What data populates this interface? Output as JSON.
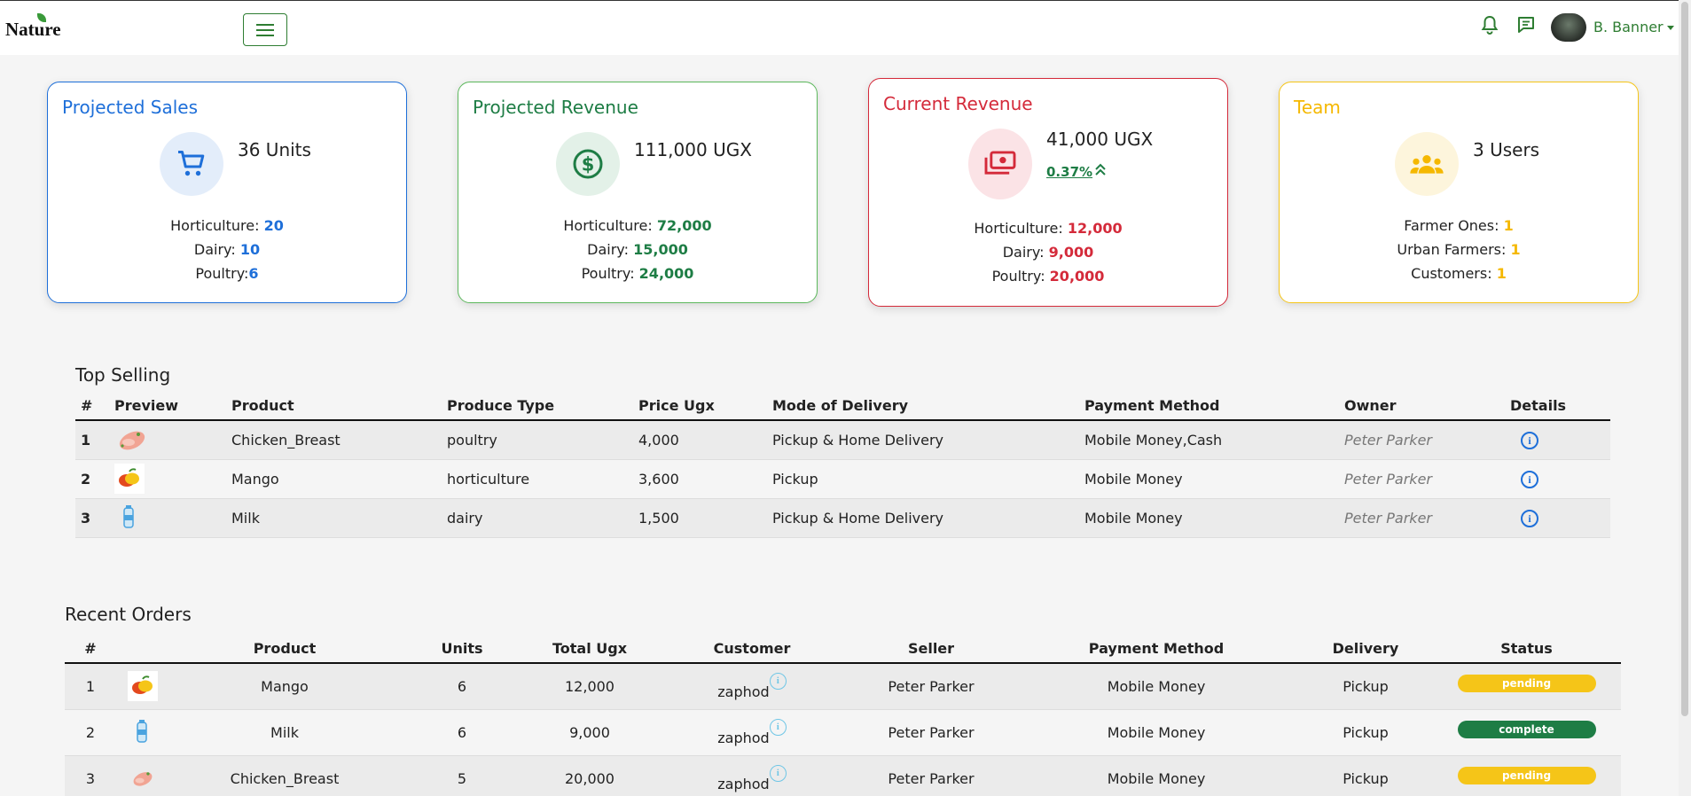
{
  "app": {
    "brand": "Nature",
    "user": "B. Banner"
  },
  "cards": {
    "projected_sales": {
      "title": "Projected Sales",
      "value": "36 Units",
      "lines": [
        {
          "label": "Horticulture: ",
          "value": "20"
        },
        {
          "label": "Dairy: ",
          "value": "10"
        },
        {
          "label": "Poultry:",
          "value": "6"
        }
      ]
    },
    "projected_revenue": {
      "title": "Projected Revenue",
      "value": "111,000 UGX",
      "lines": [
        {
          "label": "Horticulture: ",
          "value": "72,000"
        },
        {
          "label": "Dairy: ",
          "value": "15,000"
        },
        {
          "label": "Poultry: ",
          "value": "24,000"
        }
      ]
    },
    "current_revenue": {
      "title": "Current Revenue",
      "value": "41,000 UGX",
      "change": "0.37%",
      "lines": [
        {
          "label": "Horticulture: ",
          "value": "12,000"
        },
        {
          "label": "Dairy: ",
          "value": "9,000"
        },
        {
          "label": "Poultry: ",
          "value": "20,000"
        }
      ]
    },
    "team": {
      "title": "Team",
      "value": "3 Users",
      "lines": [
        {
          "label": "Farmer Ones: ",
          "value": "1"
        },
        {
          "label": "Urban Farmers: ",
          "value": "1"
        },
        {
          "label": "Customers: ",
          "value": "1"
        }
      ]
    }
  },
  "top_selling": {
    "title": "Top Selling",
    "headers": [
      "#",
      "Preview",
      "Product",
      "Produce Type",
      "Price Ugx",
      "Mode of Delivery",
      "Payment Method",
      "Owner",
      "Details"
    ],
    "rows": [
      {
        "n": "1",
        "product": "Chicken_Breast",
        "type": "poultry",
        "price": "4,000",
        "delivery": "Pickup & Home Delivery",
        "payment": "Mobile Money,Cash",
        "owner": "Peter Parker",
        "icon": "chicken-icon"
      },
      {
        "n": "2",
        "product": "Mango",
        "type": "horticulture",
        "price": "3,600",
        "delivery": "Pickup",
        "payment": "Mobile Money",
        "owner": "Peter Parker",
        "icon": "mango-icon"
      },
      {
        "n": "3",
        "product": "Milk",
        "type": "dairy",
        "price": "1,500",
        "delivery": "Pickup & Home Delivery",
        "payment": "Mobile Money",
        "owner": "Peter Parker",
        "icon": "milk-icon"
      }
    ]
  },
  "recent_orders": {
    "title": "Recent Orders",
    "headers": [
      "#",
      "Product",
      "Units",
      "Total Ugx",
      "Customer",
      "Seller",
      "Payment Method",
      "Delivery",
      "Status"
    ],
    "rows": [
      {
        "n": "1",
        "product": "Mango",
        "units": "6",
        "total": "12,000",
        "customer": "zaphod",
        "seller": "Peter Parker",
        "payment": "Mobile Money",
        "delivery": "Pickup",
        "status": "pending",
        "icon": "mango-icon"
      },
      {
        "n": "2",
        "product": "Milk",
        "units": "6",
        "total": "9,000",
        "customer": "zaphod",
        "seller": "Peter Parker",
        "payment": "Mobile Money",
        "delivery": "Pickup",
        "status": "complete",
        "icon": "milk-icon"
      },
      {
        "n": "3",
        "product": "Chicken_Breast",
        "units": "5",
        "total": "20,000",
        "customer": "zaphod",
        "seller": "Peter Parker",
        "payment": "Mobile Money",
        "delivery": "Pickup",
        "status": "pending",
        "icon": "chicken-icon"
      }
    ]
  },
  "colors": {
    "blue": "#1e6fd9",
    "green": "#1e7d45",
    "red": "#d42a3a",
    "yellow": "#f5b800",
    "complete": "#1e7d45",
    "pending": "#f5b800"
  }
}
